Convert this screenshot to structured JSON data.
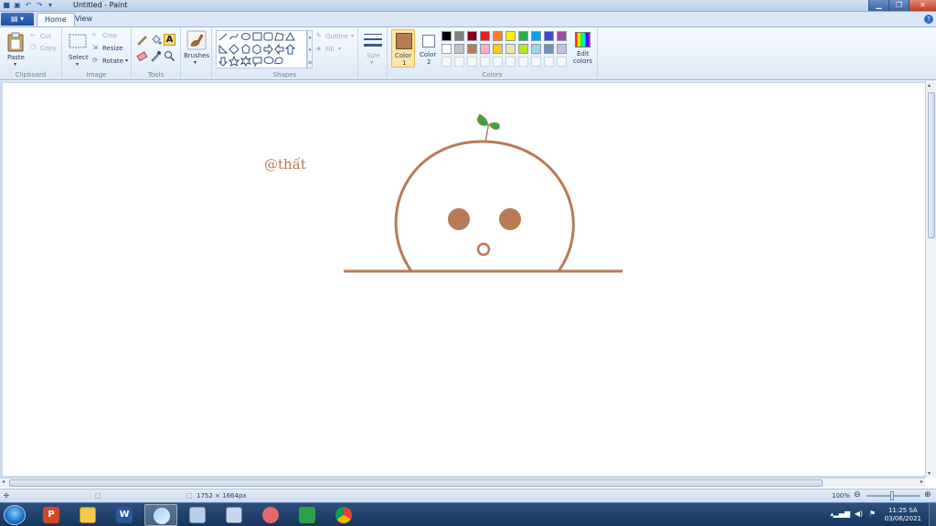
{
  "window": {
    "title": "Untitled - Paint",
    "tabs": [
      "Home",
      "View"
    ]
  },
  "ribbon": {
    "clipboard": {
      "label": "Clipboard",
      "paste": "Paste",
      "cut": "Cut",
      "copy": "Copy"
    },
    "image": {
      "label": "Image",
      "select": "Select",
      "crop": "Crop",
      "resize": "Resize",
      "rotate": "Rotate"
    },
    "tools": {
      "label": "Tools"
    },
    "brushes": {
      "label": "Brushes"
    },
    "shapes": {
      "label": "Shapes",
      "outline": "Outline",
      "fill": "Fill"
    },
    "size": {
      "label": "Size"
    },
    "colors": {
      "label": "Colors",
      "color1": "Color",
      "color1_num": "1",
      "color2": "Color",
      "color2_num": "2",
      "edit": "Edit",
      "edit2": "colors",
      "color1_value": "#b97a57",
      "color2_value": "#ffffff",
      "palette_row1": [
        "#000000",
        "#7f7f7f",
        "#880015",
        "#ed1c24",
        "#ff7f27",
        "#fff200",
        "#22b14c",
        "#00a2e8",
        "#3f48cc",
        "#a349a4"
      ],
      "palette_row2": [
        "#ffffff",
        "#c3c3c3",
        "#b97a57",
        "#ffaec9",
        "#ffc90e",
        "#efe4b0",
        "#b5e61d",
        "#99d9ea",
        "#7092be",
        "#c8bfe7"
      ]
    }
  },
  "canvas": {
    "annotation": "@thất",
    "stroke_color": "#b97a57",
    "sprout_color": "#3aa04a"
  },
  "status": {
    "dimensions": "1752 × 1664px",
    "zoom": "100%"
  },
  "taskbar": {
    "time": "11:25 SA",
    "date": "03/06/2021"
  }
}
